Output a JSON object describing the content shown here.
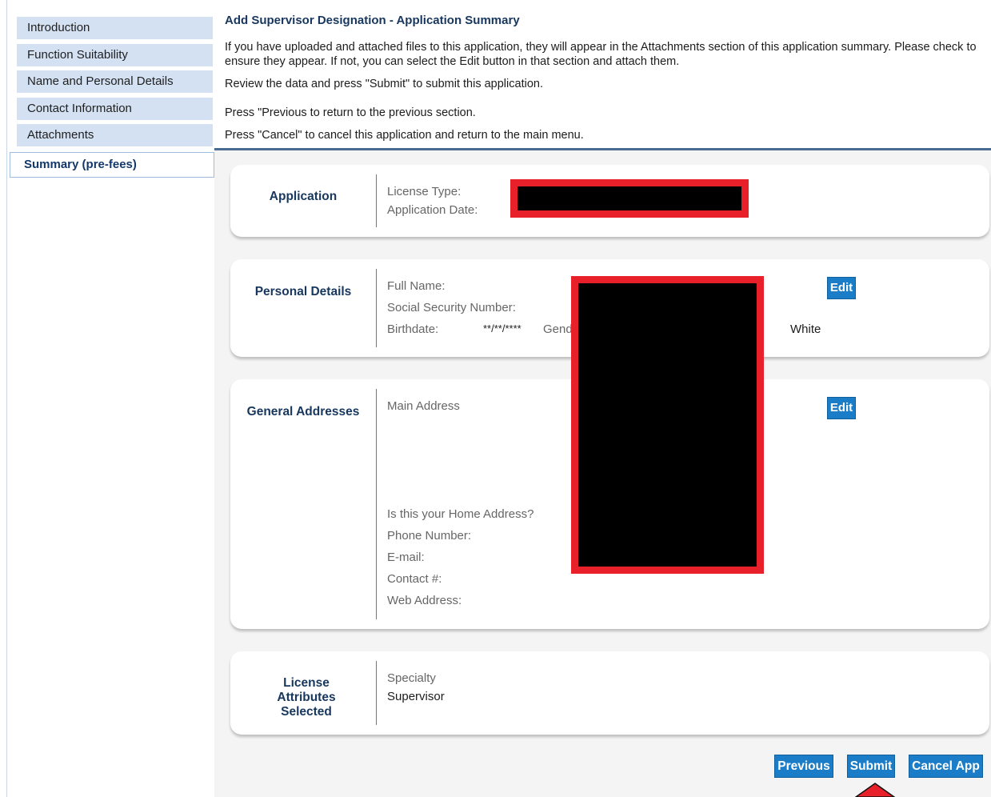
{
  "sidebar": {
    "items": [
      {
        "label": "Introduction"
      },
      {
        "label": "Function Suitability"
      },
      {
        "label": "Name and Personal Details"
      },
      {
        "label": "Contact Information"
      },
      {
        "label": "Attachments"
      },
      {
        "label": "Summary (pre-fees)"
      }
    ],
    "active_index": 5
  },
  "header": {
    "title": "Add Supervisor Designation - Application Summary",
    "line1": "If you have uploaded and attached files to this application, they will appear in the Attachments section of this application summary. Please check to ensure they appear. If not, you can select the Edit button in that section and attach them.",
    "line2": "Review the data and press \"Submit\" to submit this application.",
    "line3": "Press \"Previous to return to the previous section.",
    "line4": "Press \"Cancel\" to cancel this application and return to the main menu."
  },
  "cards": {
    "application": {
      "heading": "Application",
      "license_type_label": "License Type:",
      "application_date_label": "Application Date:"
    },
    "personal": {
      "heading": "Personal Details",
      "full_name_label": "Full Name:",
      "ssn_label": "Social Security Number:",
      "birthdate_label": "Birthdate:",
      "birthdate_value": "**/**/****",
      "gender_label_partial": "Gend",
      "race_value": "White",
      "edit_label": "Edit"
    },
    "addresses": {
      "heading": "General Addresses",
      "main_address_label": "Main Address",
      "home_address_label": "Is this your Home Address?",
      "phone_label": "Phone Number:",
      "email_label": "E-mail:",
      "contact_label": "Contact #:",
      "web_label": "Web Address:",
      "edit_label": "Edit"
    },
    "license": {
      "heading": "License Attributes Selected",
      "specialty_label": "Specialty",
      "specialty_value": "Supervisor"
    }
  },
  "buttons": {
    "previous": "Previous",
    "submit": "Submit",
    "cancel": "Cancel App"
  },
  "colors": {
    "accent": "#1b7dc7",
    "heading": "#17375e",
    "redaction_border": "#e8202a",
    "nav_bg": "#d3e1f2"
  }
}
